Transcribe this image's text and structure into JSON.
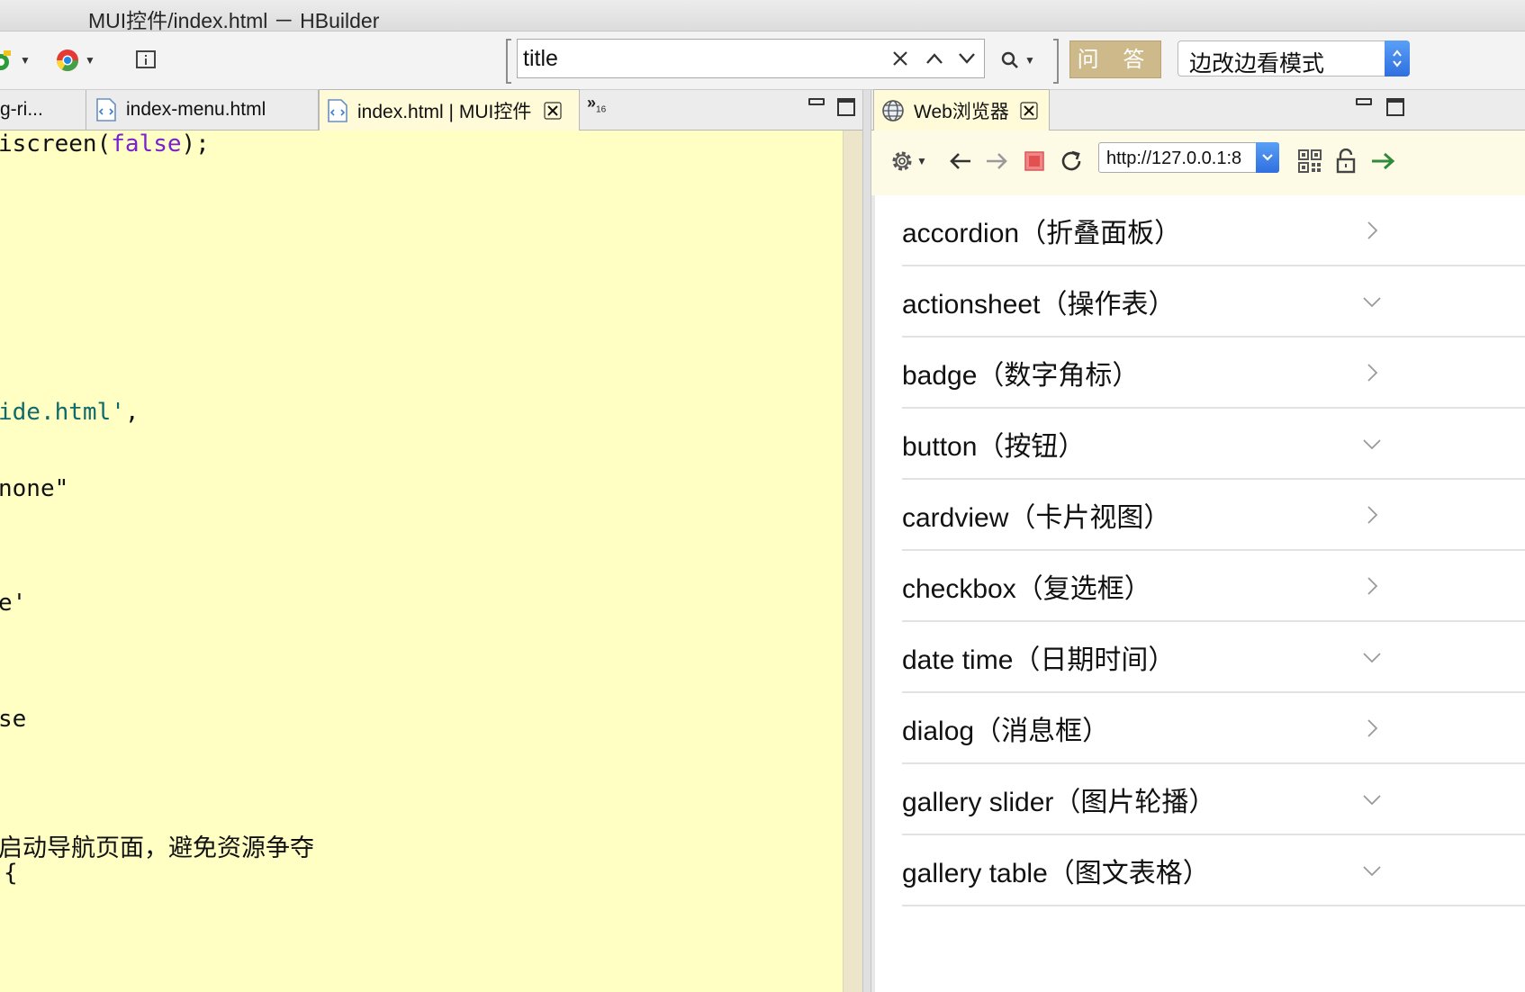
{
  "window": {
    "title": "MUI控件/index.html － HBuilder"
  },
  "toolbar": {
    "search_value": "title",
    "qa_label": "问 答",
    "mode_selected": "边改边看模式"
  },
  "editor": {
    "tabs": [
      {
        "label": "g-ri..."
      },
      {
        "label": "index-menu.html"
      },
      {
        "label": "index.html | MUI控件",
        "active": true
      }
    ],
    "overflow_label": "»",
    "overflow_count": "16",
    "code": {
      "l1_a": "iscreen(",
      "l1_b": "false",
      "l1_c": ");",
      "l2_a": "ide.html'",
      "l2_b": ",",
      "l3": "none\"",
      "l4": "e'",
      "l5": "se",
      "l6": "启动导航页面，避免资源争夺",
      "l7": "{"
    }
  },
  "browser": {
    "tab_label": "Web浏览器",
    "url": "http://127.0.0.1:8",
    "items": [
      {
        "label": "accordion（折叠面板）",
        "chevron": "right"
      },
      {
        "label": "actionsheet（操作表）",
        "chevron": "down"
      },
      {
        "label": "badge（数字角标）",
        "chevron": "right"
      },
      {
        "label": "button（按钮）",
        "chevron": "down"
      },
      {
        "label": "cardview（卡片视图）",
        "chevron": "right"
      },
      {
        "label": "checkbox（复选框）",
        "chevron": "right"
      },
      {
        "label": "date time（日期时间）",
        "chevron": "down"
      },
      {
        "label": "dialog（消息框）",
        "chevron": "right"
      },
      {
        "label": "gallery slider（图片轮播）",
        "chevron": "down"
      },
      {
        "label": "gallery table（图文表格）",
        "chevron": "down"
      }
    ]
  },
  "colors": {
    "editor_bg": "#ffffc4",
    "accent_blue": "#2f6fe0",
    "qa_button": "#cdb98a"
  }
}
